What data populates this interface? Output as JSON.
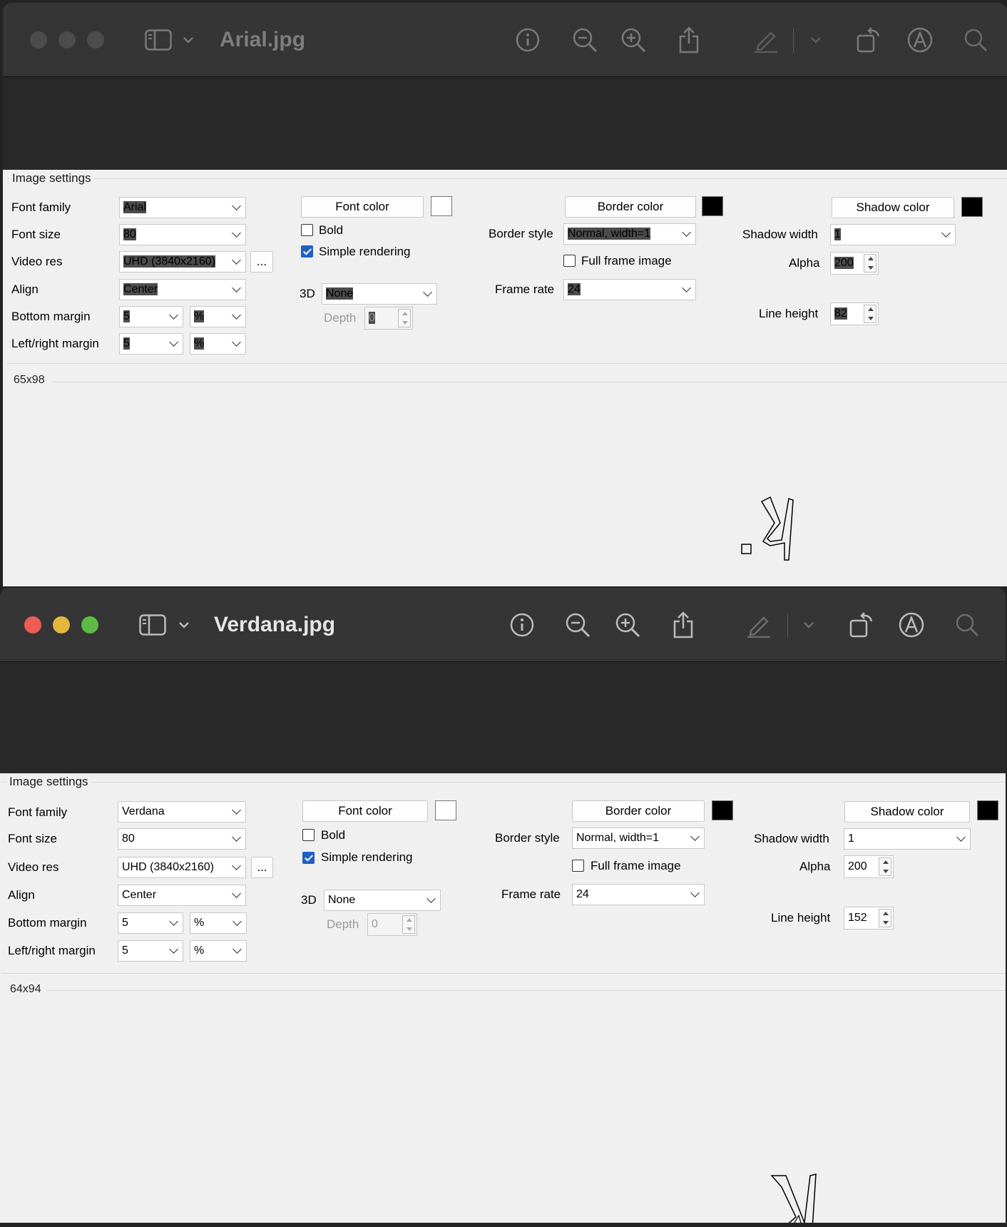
{
  "windows": [
    {
      "title": "Arial.jpg",
      "active": false,
      "settings": {
        "group_title": "Image settings",
        "font_family_label": "Font family",
        "font_family": "Arial",
        "font_size_label": "Font size",
        "font_size": "80",
        "video_res_label": "Video res",
        "video_res": "UHD (3840x2160)",
        "more_label": "...",
        "align_label": "Align",
        "align": "Center",
        "bottom_margin_label": "Bottom margin",
        "bottom_margin": "5",
        "bottom_margin_unit": "%",
        "lr_margin_label": "Left/right margin",
        "lr_margin": "5",
        "lr_margin_unit": "%",
        "font_color_label": "Font color",
        "font_color": "#ffffff",
        "bold_label": "Bold",
        "bold": false,
        "simple_rendering_label": "Simple rendering",
        "simple_rendering": true,
        "three_d_label": "3D",
        "three_d": "None",
        "depth_label": "Depth",
        "depth": "0",
        "border_color_label": "Border color",
        "border_color": "#000000",
        "border_style_label": "Border style",
        "border_style": "Normal, width=1",
        "full_frame_label": "Full frame image",
        "full_frame": false,
        "frame_rate_label": "Frame rate",
        "frame_rate": "24",
        "shadow_color_label": "Shadow color",
        "shadow_color": "#000000",
        "shadow_width_label": "Shadow width",
        "shadow_width": "1",
        "alpha_label": "Alpha",
        "alpha": "200",
        "line_height_label": "Line height",
        "line_height": "82"
      },
      "preview_size": "65x98"
    },
    {
      "title": "Verdana.jpg",
      "active": true,
      "settings": {
        "group_title": "Image settings",
        "font_family_label": "Font family",
        "font_family": "Verdana",
        "font_size_label": "Font size",
        "font_size": "80",
        "video_res_label": "Video res",
        "video_res": "UHD (3840x2160)",
        "more_label": "...",
        "align_label": "Align",
        "align": "Center",
        "bottom_margin_label": "Bottom margin",
        "bottom_margin": "5",
        "bottom_margin_unit": "%",
        "lr_margin_label": "Left/right margin",
        "lr_margin": "5",
        "lr_margin_unit": "%",
        "font_color_label": "Font color",
        "font_color": "#ffffff",
        "bold_label": "Bold",
        "bold": false,
        "simple_rendering_label": "Simple rendering",
        "simple_rendering": true,
        "three_d_label": "3D",
        "three_d": "None",
        "depth_label": "Depth",
        "depth": "0",
        "border_color_label": "Border color",
        "border_color": "#000000",
        "border_style_label": "Border style",
        "border_style": "Normal, width=1",
        "full_frame_label": "Full frame image",
        "full_frame": false,
        "frame_rate_label": "Frame rate",
        "frame_rate": "24",
        "shadow_color_label": "Shadow color",
        "shadow_color": "#000000",
        "shadow_width_label": "Shadow width",
        "shadow_width": "1",
        "alpha_label": "Alpha",
        "alpha": "200",
        "line_height_label": "Line height",
        "line_height": "152"
      },
      "preview_size": "64x94"
    }
  ],
  "toolbar_icons": [
    "sidebar-icon",
    "chevron-down-icon",
    "info-icon",
    "zoom-out-icon",
    "zoom-in-icon",
    "share-icon",
    "markup-pen-icon",
    "chevron-down-icon",
    "rotate-icon",
    "annotate-icon",
    "search-icon"
  ],
  "preview_glyph": "ל׳"
}
